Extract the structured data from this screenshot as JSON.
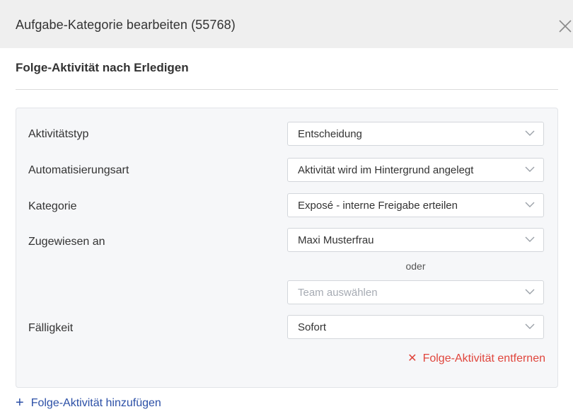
{
  "dialog": {
    "title": "Aufgabe-Kategorie bearbeiten (55768)",
    "close_icon": "close-icon"
  },
  "section": {
    "title": "Folge-Aktivität nach Erledigen"
  },
  "form": {
    "activity_type": {
      "label": "Aktivitätstyp",
      "value": "Entscheidung"
    },
    "automation_type": {
      "label": "Automatisierungsart",
      "value": "Aktivität wird im Hintergrund angelegt"
    },
    "category": {
      "label": "Kategorie",
      "value": "Exposé - interne Freigabe erteilen"
    },
    "assigned_to": {
      "label": "Zugewiesen an",
      "value": "Maxi Musterfrau"
    },
    "or_text": "oder",
    "team": {
      "placeholder": "Team auswählen"
    },
    "due": {
      "label": "Fälligkeit",
      "value": "Sofort"
    },
    "remove_label": "Folge-Aktivität entfernen",
    "remove_icon": "x-icon"
  },
  "footer": {
    "add_label": "Folge-Aktivität hinzufügen",
    "add_icon": "plus-icon"
  },
  "colors": {
    "header_bg": "#efefef",
    "card_bg": "#f6f7f9",
    "danger": "#e0463d",
    "link": "#2b4fa6"
  }
}
